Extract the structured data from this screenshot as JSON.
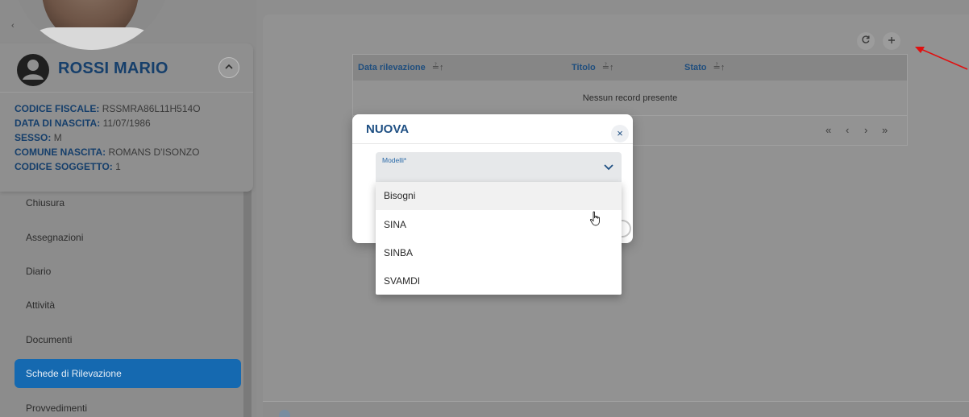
{
  "patient": {
    "name": "ROSSI MARIO",
    "info": [
      {
        "key": "CODICE FISCALE:",
        "value": "RSSMRA86L11H514O"
      },
      {
        "key": "DATA DI NASCITA:",
        "value": "11/07/1986"
      },
      {
        "key": "SESSO:",
        "value": "M"
      },
      {
        "key": "COMUNE NASCITA:",
        "value": "ROMANS D'ISONZO"
      },
      {
        "key": "CODICE SOGGETTO:",
        "value": "1"
      }
    ]
  },
  "sidebar": {
    "items": [
      {
        "label": "Chiusura"
      },
      {
        "label": "Assegnazioni"
      },
      {
        "label": "Diario"
      },
      {
        "label": "Attività"
      },
      {
        "label": "Documenti"
      },
      {
        "label": "Schede di Rilevazione",
        "active": true
      },
      {
        "label": "Provvedimenti"
      }
    ]
  },
  "toolbar": {
    "refresh_icon": "refresh-icon",
    "add_icon": "plus-icon"
  },
  "table": {
    "columns": [
      "Data rilevazione",
      "Titolo",
      "Stato"
    ],
    "empty_message": "Nessun record presente",
    "pager": [
      "«",
      "‹",
      "›",
      "»"
    ]
  },
  "modal": {
    "title": "NUOVA",
    "select_label": "Modelli*",
    "options": [
      "Bisogni",
      "SINA",
      "SINBA",
      "SVAMDI"
    ]
  },
  "colors": {
    "accent": "#1569b0",
    "title": "#1e4f83",
    "annotation_arrow": "#e01010"
  }
}
